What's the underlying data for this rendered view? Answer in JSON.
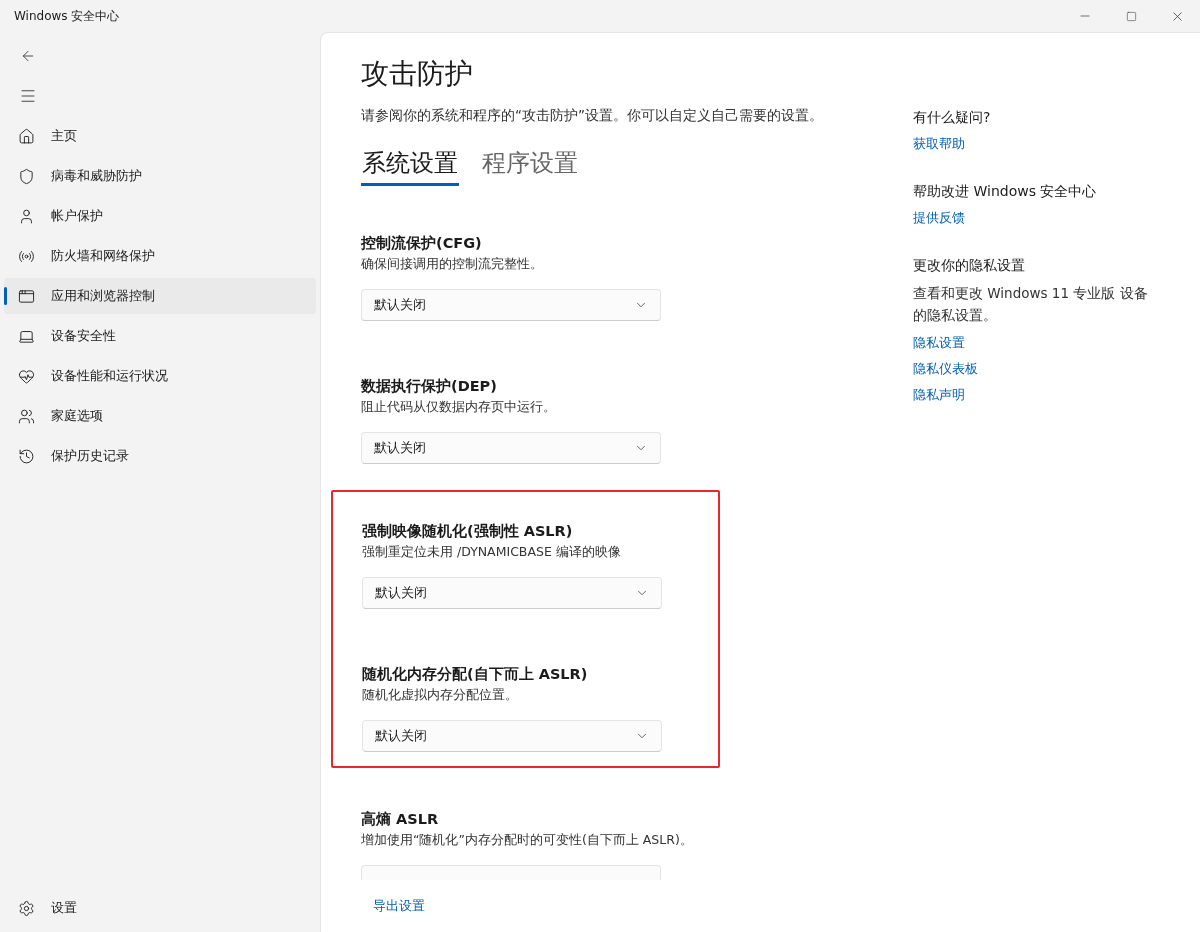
{
  "window": {
    "title": "Windows 安全中心"
  },
  "sidebar": {
    "items": [
      {
        "label": "主页",
        "selected": false
      },
      {
        "label": "病毒和威胁防护",
        "selected": false
      },
      {
        "label": "帐户保护",
        "selected": false
      },
      {
        "label": "防火墙和网络保护",
        "selected": false
      },
      {
        "label": "应用和浏览器控制",
        "selected": true
      },
      {
        "label": "设备安全性",
        "selected": false
      },
      {
        "label": "设备性能和运行状况",
        "selected": false
      },
      {
        "label": "家庭选项",
        "selected": false
      },
      {
        "label": "保护历史记录",
        "selected": false
      }
    ],
    "footer": {
      "label": "设置"
    }
  },
  "page": {
    "title": "攻击防护",
    "subtitle": "请参阅你的系统和程序的“攻击防护”设置。你可以自定义自己需要的设置。",
    "tabs": [
      {
        "label": "系统设置",
        "selected": true
      },
      {
        "label": "程序设置",
        "selected": false
      }
    ]
  },
  "settings": [
    {
      "title": "控制流保护(CFG)",
      "description": "确保间接调用的控制流完整性。",
      "value": "默认关闭",
      "highlighted": false
    },
    {
      "title": "数据执行保护(DEP)",
      "description": "阻止代码从仅数据内存页中运行。",
      "value": "默认关闭",
      "highlighted": false
    },
    {
      "title": "强制映像随机化(强制性 ASLR)",
      "description": "强制重定位未用 /DYNAMICBASE 编译的映像",
      "value": "默认关闭",
      "highlighted": true
    },
    {
      "title": "随机化内存分配(自下而上 ASLR)",
      "description": "随机化虚拟内存分配位置。",
      "value": "默认关闭",
      "highlighted": true
    },
    {
      "title": "高熵 ASLR",
      "description": "增加使用“随机化”内存分配时的可变性(自下而上 ASLR)。",
      "highlighted": false
    }
  ],
  "footer_link": "导出设置",
  "aside": [
    {
      "heading": "有什么疑问?",
      "links": [
        "获取帮助"
      ]
    },
    {
      "heading": "帮助改进 Windows 安全中心",
      "links": [
        "提供反馈"
      ]
    },
    {
      "heading": "更改你的隐私设置",
      "text": "查看和更改 Windows 11 专业版 设备的隐私设置。",
      "links": [
        "隐私设置",
        "隐私仪表板",
        "隐私声明"
      ]
    }
  ]
}
